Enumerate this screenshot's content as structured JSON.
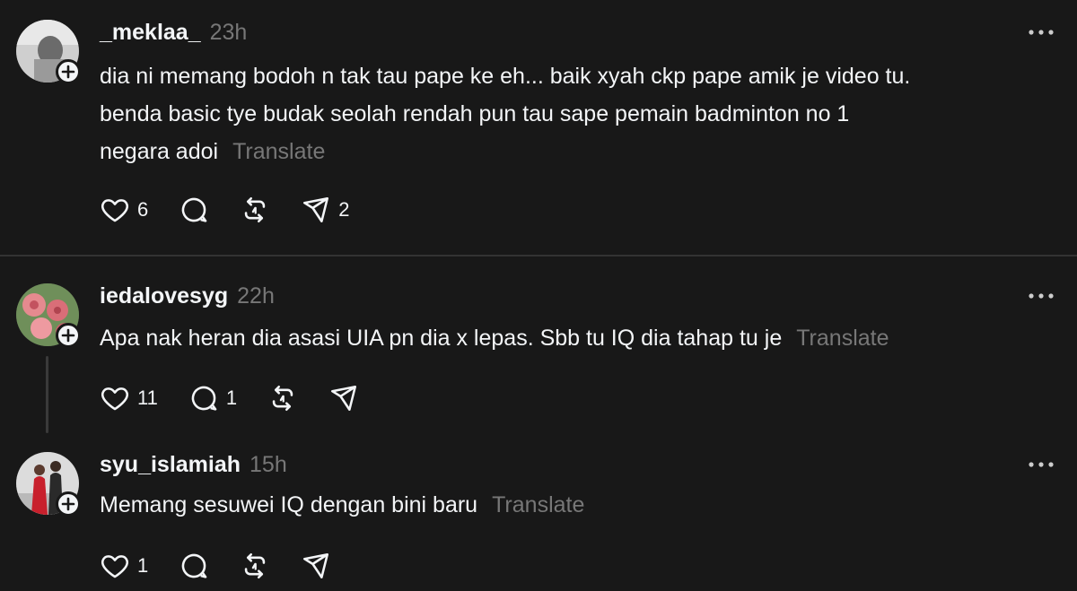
{
  "posts": [
    {
      "username": "_meklaa_",
      "time": "23h",
      "lines": [
        "dia ni memang bodoh n tak tau pape ke eh... baik xyah ckp pape amik je video tu.",
        "benda basic tye budak seolah rendah pun tau sape pemain badminton no 1",
        "negara adoi"
      ],
      "translate": "Translate",
      "likes": "6",
      "replies": "",
      "reposts": "",
      "shares": "2"
    },
    {
      "username": "iedalovesyg",
      "time": "22h",
      "lines": [
        "Apa nak heran dia asasi UIA pn dia x lepas. Sbb tu IQ dia tahap tu je"
      ],
      "translate": "Translate",
      "likes": "11",
      "replies": "1",
      "reposts": "",
      "shares": ""
    },
    {
      "username": "syu_islamiah",
      "time": "15h",
      "lines": [
        "Memang sesuwei IQ dengan bini baru"
      ],
      "translate": "Translate",
      "likes": "1",
      "replies": "",
      "reposts": "",
      "shares": ""
    }
  ],
  "icons": {
    "like": "heart-icon",
    "reply": "comment-icon",
    "repost": "repost-icon",
    "share": "send-icon",
    "more": "more-dots-icon",
    "follow": "plus-icon"
  },
  "colors": {
    "background": "#181818",
    "text": "#f3f5f7",
    "muted": "#777777",
    "divider": "#333333"
  }
}
